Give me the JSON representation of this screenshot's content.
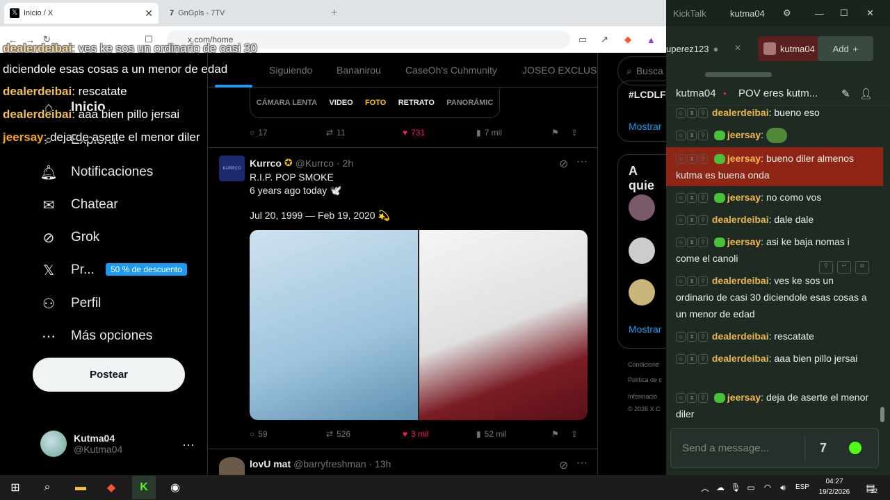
{
  "browser": {
    "tabs": [
      {
        "title": "Inicio / X",
        "close": "✕"
      },
      {
        "title": "GnGpls - 7TV"
      }
    ],
    "url": "x.com/home"
  },
  "twitter": {
    "nav": [
      {
        "label": "Inicio",
        "icon": "home-icon"
      },
      {
        "label": "Explorar",
        "icon": "search-icon"
      },
      {
        "label": "Notificaciones",
        "icon": "bell-icon"
      },
      {
        "label": "Chatear",
        "icon": "mail-icon"
      },
      {
        "label": "Grok",
        "icon": "grok-icon"
      },
      {
        "label": "Pr...",
        "icon": "x-logo-icon"
      },
      {
        "label": "Perfil",
        "icon": "person-icon"
      },
      {
        "label": "Más opciones",
        "icon": "more-circle-icon"
      }
    ],
    "premium_badge": "50 % de descuento",
    "post_button": "Postear",
    "profile": {
      "name": "Kutma04",
      "handle": "@Kutma04",
      "more": "···"
    },
    "feed_tabs": [
      "Siguiendo",
      "Bananirou",
      "CaseOh's Cuhmunity",
      "JOSEO EXCLUSIV"
    ],
    "camera_modes": [
      "CÁMARA LENTA",
      "VIDEO",
      "FOTO",
      "RETRATO",
      "PANORÁMIC"
    ],
    "tweet1_actions": {
      "replies": "17",
      "retweets": "11",
      "likes": "731",
      "views": "7 mil"
    },
    "tweet2": {
      "avatar_text": "KURRCO",
      "name": "Kurrco",
      "handle": "@Kurrco · 2h",
      "line1": "R.I.P. POP SMOKE",
      "line2": "6 years ago today 🕊️",
      "dates": "Jul 20, 1999 — Feb 19, 2020 💫",
      "actions": {
        "replies": "59",
        "retweets": "526",
        "likes": "3 mil",
        "views": "52 mil"
      }
    },
    "tweet3": {
      "name": "lovU mat",
      "handle": "@barryfreshman · 13h"
    },
    "right": {
      "search": "Busca",
      "trend": "#LCDLF",
      "show_more": "Mostrar",
      "who_to_follow": "A quie",
      "show_more2": "Mostrar",
      "footer": [
        "Condicione",
        "Política de c",
        "Informació",
        "© 2026 X C"
      ]
    }
  },
  "overlay_chat": [
    {
      "user": "dealerdeibai",
      "text": ": ves ke sos un ordinario de casi 30",
      "faded": true
    },
    {
      "user": "",
      "text": "diciendole esas cosas a un menor de edad"
    },
    {
      "user": "dealerdeibai",
      "text": ": rescatate"
    },
    {
      "user": "dealerdeibai",
      "text": ": aaa bien pillo jersai"
    },
    {
      "user": "jeersay",
      "text": ": deja de aserte el menor diler"
    }
  ],
  "kicktalk": {
    "app_title": "KickTalk",
    "user": "kutma04",
    "channel_tabs": [
      {
        "label": "uperez123"
      },
      {
        "label": "kutma04"
      }
    ],
    "add_label": "Add",
    "header_channel": "kutma04",
    "header_title": "POV eres kutm...",
    "messages": [
      {
        "user": "dealerdeibai",
        "text": ": bueno eso",
        "color": "#e6b54a"
      },
      {
        "user": "jeersay",
        "text": ":",
        "emote": true,
        "color": "#f5b84a"
      },
      {
        "user": "jeersay",
        "text": ": bueno diler almenos kutma es buena onda",
        "color": "#f5b84a",
        "highlight": true
      },
      {
        "user": "jeersay",
        "text": ": no como vos",
        "color": "#f5b84a"
      },
      {
        "user": "dealerdeibai",
        "text": ": dale dale",
        "color": "#e6b54a"
      },
      {
        "user": "jeersay",
        "text": ": asi ke baja nomas i come el canoli",
        "color": "#f5b84a"
      },
      {
        "user": "dealerdeibai",
        "text": ": ves ke sos un ordinario de casi 30 diciendole esas cosas a un menor de edad",
        "color": "#e6b54a"
      },
      {
        "user": "dealerdeibai",
        "text": ": rescatate",
        "color": "#e6b54a"
      },
      {
        "user": "dealerdeibai",
        "text": ": aaa bien pillo jersai",
        "color": "#e6b54a"
      },
      {
        "user": "jeersay",
        "text": ": deja de aserte el menor diler",
        "color": "#f5b84a"
      }
    ],
    "input_placeholder": "Send a message..."
  },
  "taskbar": {
    "lang": "ESP",
    "time": "04:27",
    "date": "19/2/2026",
    "notifications": "12"
  }
}
